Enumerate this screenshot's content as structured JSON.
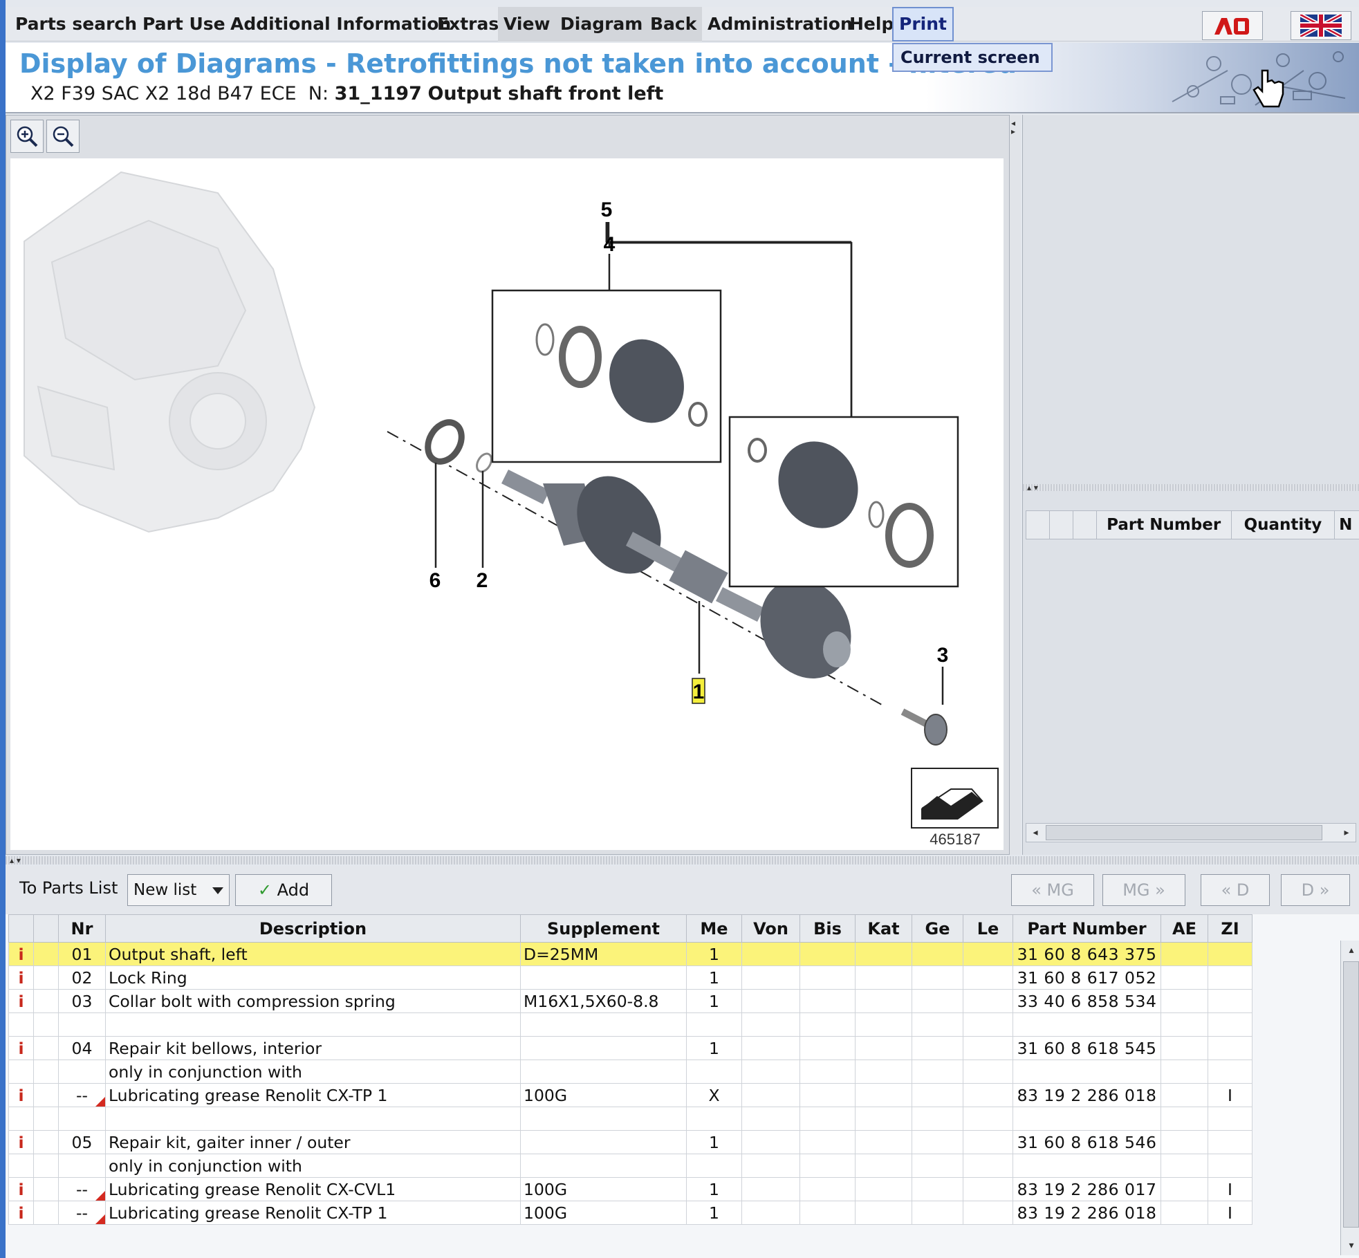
{
  "menu": {
    "items": [
      "Parts search",
      "Part Use",
      "Additional Information",
      "Extras",
      "View",
      "Diagram",
      "Back",
      "Administration",
      "Help",
      "Print"
    ],
    "print_dropdown_item": "Current screen"
  },
  "header": {
    "title": "Display of Diagrams - Retrofittings not taken into account - filtered",
    "vehicle": "X2 F39 SAC X2 18d B47 ECE",
    "n_label": "N:",
    "diagram_id": "31_1197",
    "diagram_name": "Output shaft front left"
  },
  "diagram": {
    "callouts": [
      "5",
      "4",
      "6",
      "2",
      "1",
      "3"
    ],
    "image_number": "465187"
  },
  "right_panel": {
    "columns": [
      "",
      "",
      "",
      "Part Number",
      "Quantity",
      "N"
    ]
  },
  "toolbar": {
    "to_parts_list_label": "To Parts List",
    "list_select_value": "New list",
    "add_button": "Add",
    "prev_mg": "« MG",
    "next_mg": "MG »",
    "prev_d": "« D",
    "next_d": "D »"
  },
  "parts_table": {
    "columns": [
      "",
      "",
      "Nr",
      "Description",
      "Supplement",
      "Me",
      "Von",
      "Bis",
      "Kat",
      "Ge",
      "Le",
      "Part Number",
      "AE",
      "ZI"
    ],
    "rows": [
      {
        "info": "i",
        "nr": "01",
        "description": "Output shaft, left",
        "supplement": "D=25MM",
        "me": "1",
        "part_number": "31 60 8 643 375",
        "zi": "",
        "selected": true,
        "note": false
      },
      {
        "info": "i",
        "nr": "02",
        "description": "Lock Ring",
        "supplement": "",
        "me": "1",
        "part_number": "31 60 8 617 052",
        "zi": "",
        "selected": false,
        "note": false
      },
      {
        "info": "i",
        "nr": "03",
        "description": "Collar bolt with compression spring",
        "supplement": "M16X1,5X60-8.8",
        "me": "1",
        "part_number": "33 40 6 858 534",
        "zi": "",
        "selected": false,
        "note": false
      },
      {
        "info": "",
        "nr": "",
        "description": "",
        "supplement": "",
        "me": "",
        "part_number": "",
        "zi": "",
        "selected": false,
        "note": false
      },
      {
        "info": "i",
        "nr": "04",
        "description": "Repair kit bellows, interior",
        "supplement": "",
        "me": "1",
        "part_number": "31 60 8 618 545",
        "zi": "",
        "selected": false,
        "note": false
      },
      {
        "info": "",
        "nr": "",
        "description": "only in conjunction with",
        "supplement": "",
        "me": "",
        "part_number": "",
        "zi": "",
        "selected": false,
        "note": false
      },
      {
        "info": "i",
        "nr": "--",
        "description": "Lubricating grease Renolit CX-TP 1",
        "supplement": "100G",
        "me": "X",
        "part_number": "83 19 2 286 018",
        "zi": "I",
        "selected": false,
        "note": true
      },
      {
        "info": "",
        "nr": "",
        "description": "",
        "supplement": "",
        "me": "",
        "part_number": "",
        "zi": "",
        "selected": false,
        "note": false
      },
      {
        "info": "i",
        "nr": "05",
        "description": "Repair kit, gaiter inner / outer",
        "supplement": "",
        "me": "1",
        "part_number": "31 60 8 618 546",
        "zi": "",
        "selected": false,
        "note": false
      },
      {
        "info": "",
        "nr": "",
        "description": "only in conjunction with",
        "supplement": "",
        "me": "",
        "part_number": "",
        "zi": "",
        "selected": false,
        "note": false
      },
      {
        "info": "i",
        "nr": "--",
        "description": "Lubricating grease Renolit CX-CVL1",
        "supplement": "100G",
        "me": "1",
        "part_number": "83 19 2 286 017",
        "zi": "I",
        "selected": false,
        "note": true
      },
      {
        "info": "i",
        "nr": "--",
        "description": "Lubricating grease Renolit CX-TP 1",
        "supplement": "100G",
        "me": "1",
        "part_number": "83 19 2 286 018",
        "zi": "I",
        "selected": false,
        "note": true
      }
    ]
  },
  "colors": {
    "title_blue": "#4a97d6",
    "selected_row": "#fbf37a",
    "info_red": "#c8281c"
  }
}
